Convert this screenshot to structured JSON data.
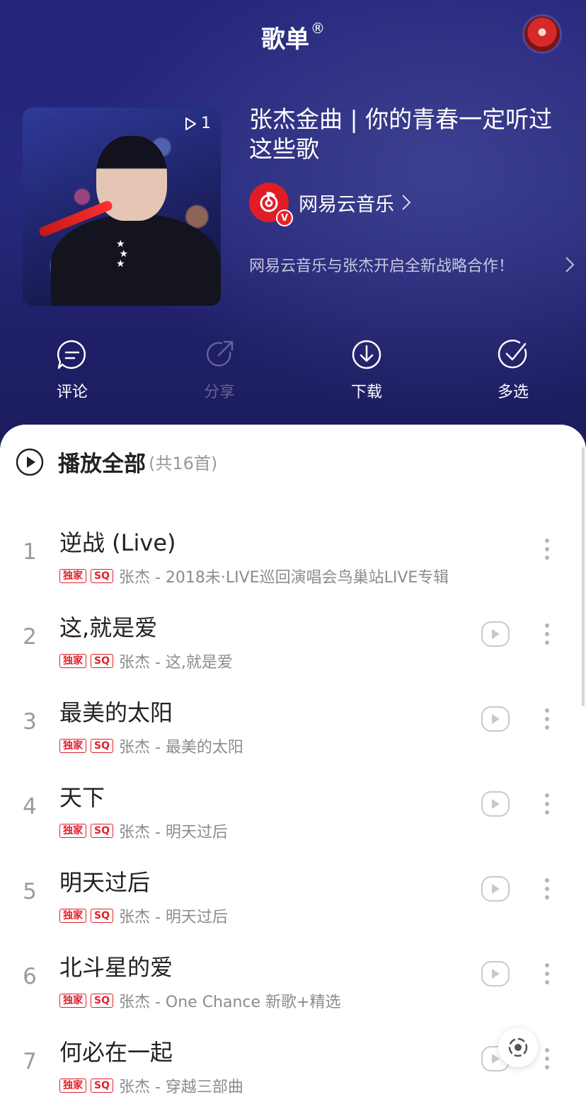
{
  "nav": {
    "title": "歌单",
    "reg_mark": "®"
  },
  "playlist": {
    "title": "张杰金曲 | 你的青春一定听过这些歌",
    "play_count": "1",
    "creator": {
      "name": "网易云音乐",
      "badge": "V"
    },
    "description": "网易云音乐与张杰开启全新战略合作！"
  },
  "actions": [
    {
      "label": "评论",
      "icon": "comment-icon",
      "enabled": true
    },
    {
      "label": "分享",
      "icon": "share-icon",
      "enabled": false
    },
    {
      "label": "下载",
      "icon": "download-icon",
      "enabled": true
    },
    {
      "label": "多选",
      "icon": "multiselect-icon",
      "enabled": true
    }
  ],
  "play_all": {
    "label": "播放全部",
    "count": "(共16首)"
  },
  "tags": {
    "exclusive": "独家",
    "sq": "SQ"
  },
  "songs": [
    {
      "index": "1",
      "title": "逆战 (Live)",
      "subtitle": "张杰 - 2018未·LIVE巡回演唱会鸟巢站LIVE专辑",
      "has_mv": false
    },
    {
      "index": "2",
      "title": "这,就是爱",
      "subtitle": "张杰 - 这,就是爱",
      "has_mv": true
    },
    {
      "index": "3",
      "title": "最美的太阳",
      "subtitle": "张杰 - 最美的太阳",
      "has_mv": true
    },
    {
      "index": "4",
      "title": "天下",
      "subtitle": "张杰 - 明天过后",
      "has_mv": true
    },
    {
      "index": "5",
      "title": "明天过后",
      "subtitle": "张杰 - 明天过后",
      "has_mv": true
    },
    {
      "index": "6",
      "title": "北斗星的爱",
      "subtitle": "张杰 - One Chance 新歌+精选",
      "has_mv": true
    },
    {
      "index": "7",
      "title": "何必在一起",
      "subtitle": "张杰 - 穿越三部曲",
      "has_mv": true
    }
  ],
  "colors": {
    "header_bg": "#25257a",
    "accent_red": "#e0212b"
  }
}
